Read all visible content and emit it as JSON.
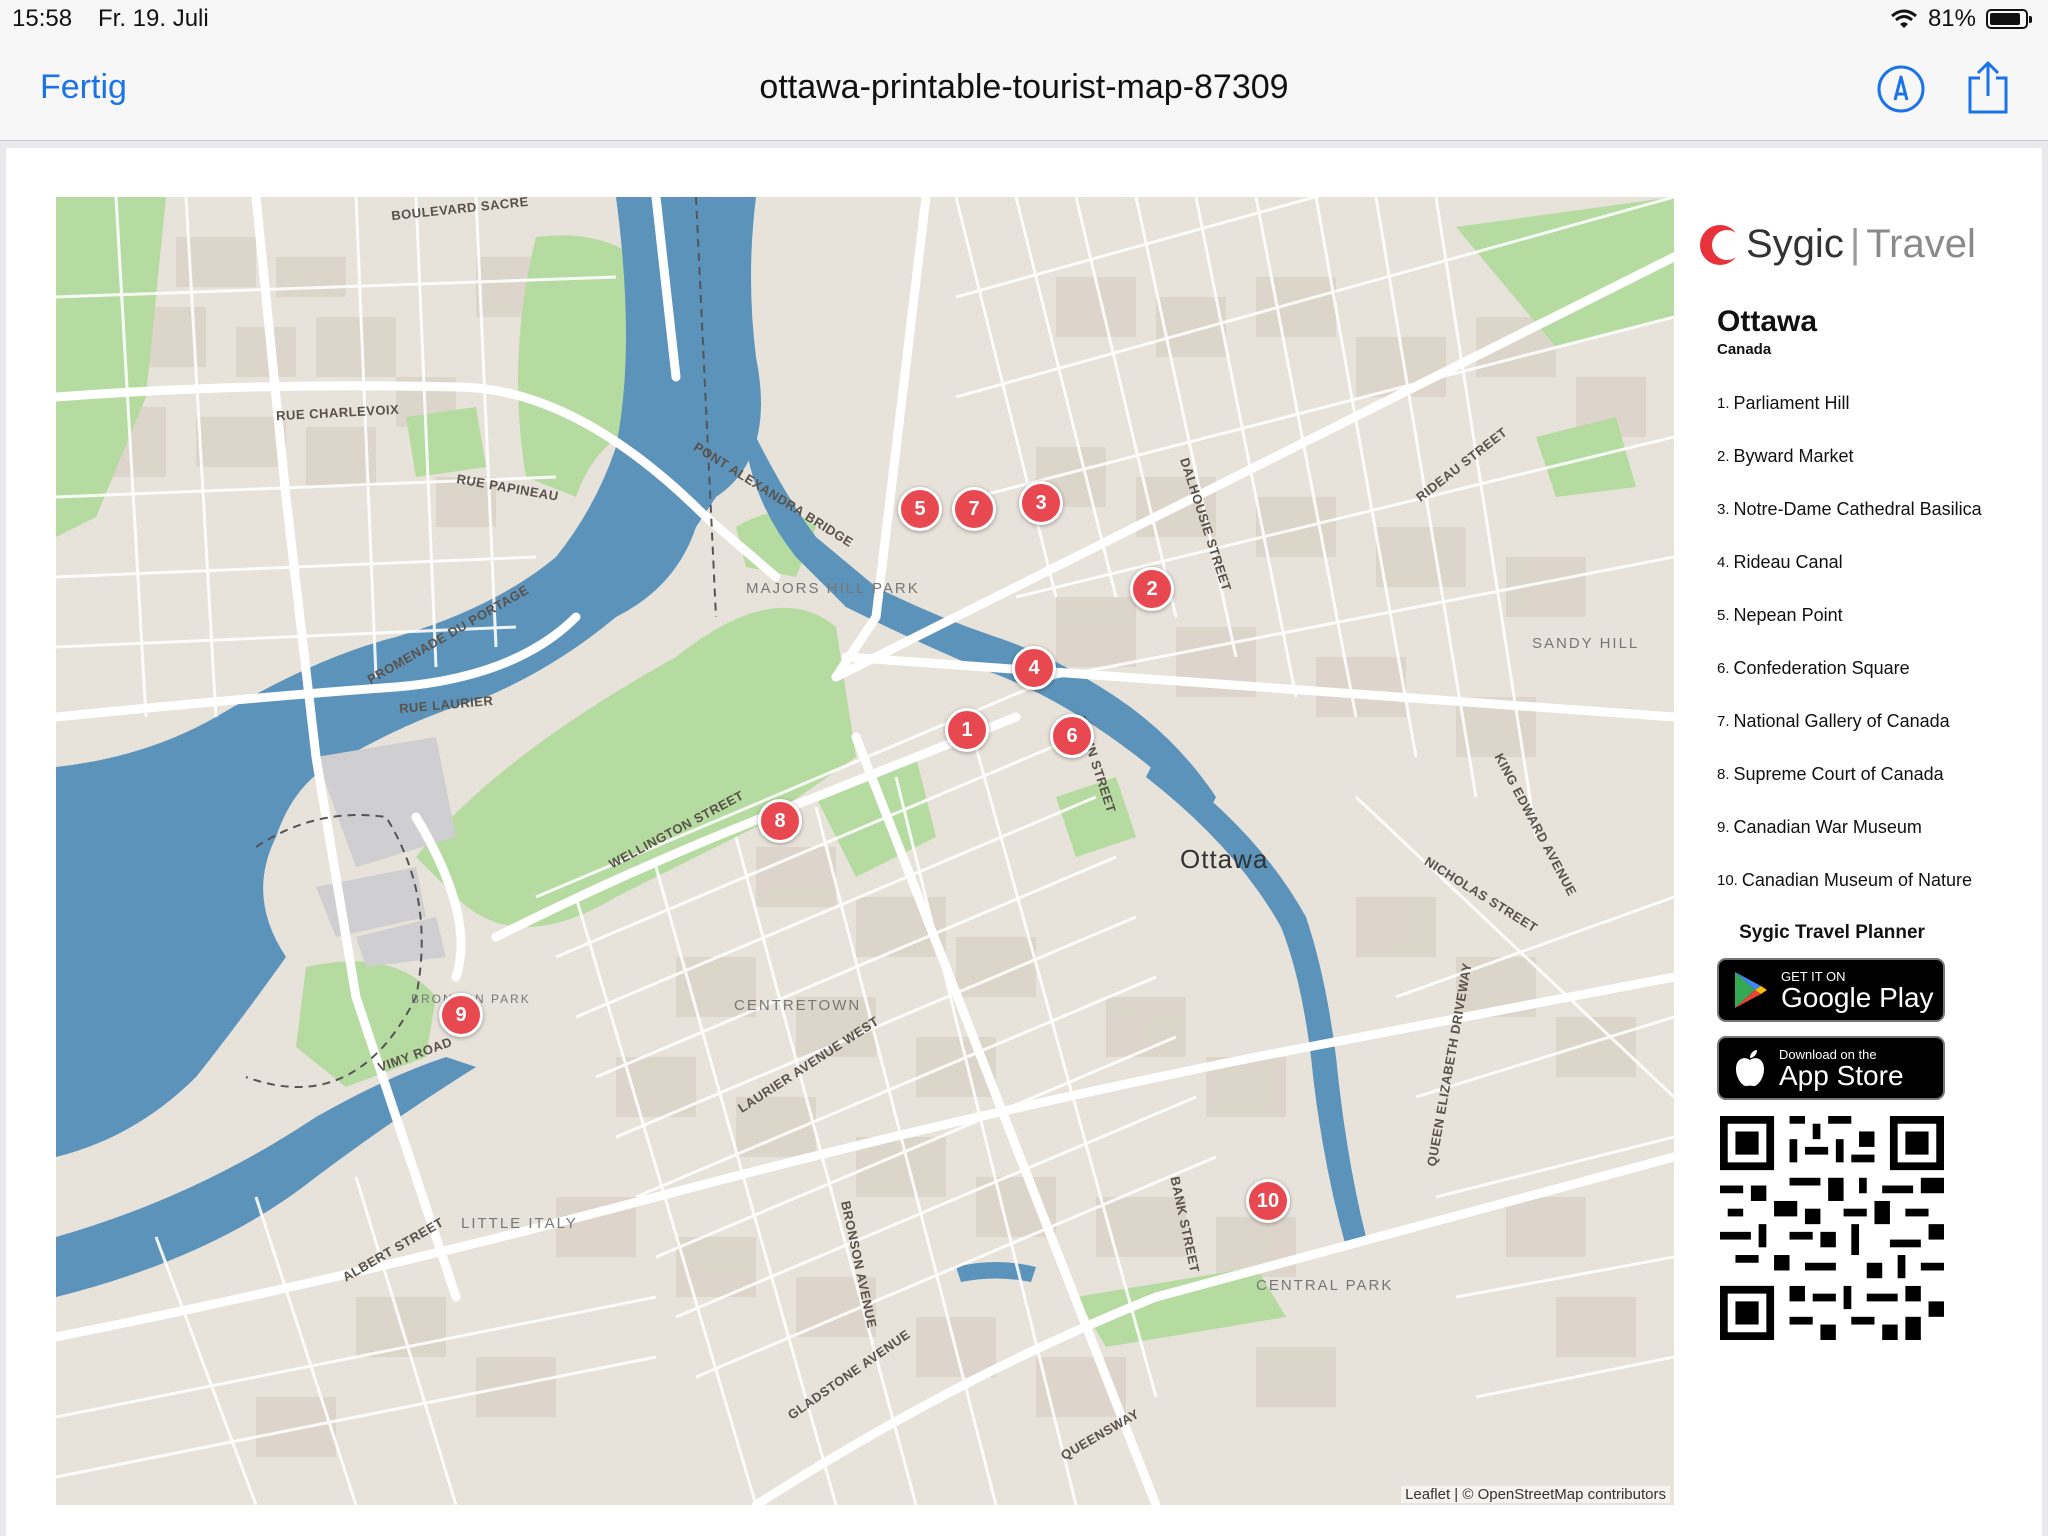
{
  "status_bar": {
    "time": "15:58",
    "date": "Fr. 19. Juli",
    "battery": "81%"
  },
  "nav": {
    "done_label": "Fertig",
    "title": "ottawa-printable-tourist-map-87309",
    "markup_icon": "markup-pen-icon",
    "share_icon": "share-icon"
  },
  "map": {
    "city_label": "Ottawa",
    "attribution": "Leaflet | © OpenStreetMap contributors",
    "labels": {
      "majors_hill_park": "MAJORS HILL PARK",
      "centretown": "CENTRETOWN",
      "sandy_hill": "SANDY HILL",
      "little_italy": "LITTLE ITALY",
      "central_park": "CENTRAL PARK",
      "bronson_park": "BRONSON PARK",
      "wellington": "WELLINGTON STREET",
      "elgin": "ELGIN STREET",
      "pont_alexandra": "PONT ALEXANDRA BRIDGE",
      "rue_laurier": "RUE LAURIER",
      "promenade": "PROMENADE DU PORTAGE",
      "queen_elizabeth": "QUEEN ELIZABETH DRIVEWAY",
      "bank": "BANK STREET",
      "bronson_ave": "BRONSON AVENUE",
      "king_edward": "KING EDWARD AVENUE",
      "rideau": "RIDEAU STREET",
      "vimy": "VIMY ROAD",
      "queensway": "QUEENSWAY",
      "gladstone": "GLADSTONE AVENUE",
      "laurier_west": "LAURIER AVENUE WEST",
      "nicholas": "NICHOLAS STREET",
      "albert": "ALBERT STREET",
      "rue_papineau": "RUE PAPINEAU",
      "rue_charlevoix": "RUE CHARLEVOIX",
      "boulevard_sacre": "BOULEVARD SACRE",
      "dalhousie": "DALHOUSIE STREET"
    },
    "pins": [
      "1",
      "2",
      "3",
      "4",
      "5",
      "6",
      "7",
      "8",
      "9",
      "10"
    ]
  },
  "sidebar": {
    "brand_main": "Sygic",
    "brand_sub": "Travel",
    "city": "Ottawa",
    "country": "Canada",
    "pois": [
      {
        "num": "1.",
        "name": "Parliament Hill"
      },
      {
        "num": "2.",
        "name": "Byward Market"
      },
      {
        "num": "3.",
        "name": "Notre-Dame Cathedral Basilica"
      },
      {
        "num": "4.",
        "name": "Rideau Canal"
      },
      {
        "num": "5.",
        "name": "Nepean Point"
      },
      {
        "num": "6.",
        "name": "Confederation Square"
      },
      {
        "num": "7.",
        "name": "National Gallery of Canada"
      },
      {
        "num": "8.",
        "name": "Supreme Court of Canada"
      },
      {
        "num": "9.",
        "name": "Canadian War Museum"
      },
      {
        "num": "10.",
        "name": "Canadian Museum of Nature"
      }
    ],
    "planner_title": "Sygic Travel Planner",
    "google_small": "GET IT ON",
    "google_large": "Google Play",
    "apple_small": "Download on the",
    "apple_large": "App Store"
  },
  "colors": {
    "accent": "#1a73e8",
    "pin": "#e84950",
    "water": "#5b93bb",
    "park": "#b5dba0",
    "land": "#e7e2da",
    "brand": "#e8323b"
  }
}
